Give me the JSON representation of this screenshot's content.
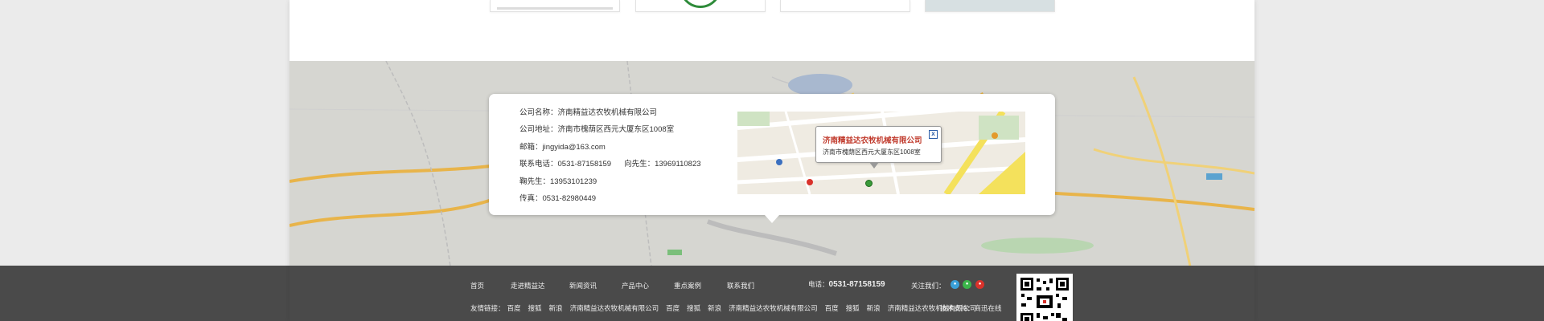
{
  "company": {
    "name_label": "公司名称：",
    "name": "济南精益达农牧机械有限公司",
    "address_label": "公司地址：",
    "address": "济南市槐荫区西元大厦东区1008室",
    "email_label": "邮箱：",
    "email": "jingyida@163.com",
    "phone_label": "联系电话：",
    "phone": "0531-87158159",
    "contact2_label": "向先生：",
    "contact2": "13969110823",
    "contact3_label": "鞠先生：",
    "contact3": "13953101239",
    "fax_label": "传真：",
    "fax": "0531-82980449"
  },
  "map_popup": {
    "title": "济南精益达农牧机械有限公司",
    "address": "济南市槐荫区西元大厦东区1008室",
    "close": "x"
  },
  "footer": {
    "nav": [
      "首页",
      "走进精益达",
      "新闻资讯",
      "产品中心",
      "重点案例",
      "联系我们"
    ],
    "phone_label": "电话：",
    "phone": "0531-87158159",
    "follow_label": "关注我们：",
    "links_label": "友情链接：",
    "links": [
      "百度",
      "搜狐",
      "新浪",
      "济南精益达农牧机械有限公司",
      "百度",
      "搜狐",
      "新浪",
      "济南精益达农牧机械有限公司",
      "百度",
      "搜狐",
      "新浪",
      "济南精益达农牧机械有限公司"
    ],
    "tech_support": "技术支持：商迅在线"
  },
  "colors": {
    "footer_bg": "#4a4a4a",
    "popup_title": "#c0392b",
    "map_bg": "#d9d9d4"
  }
}
